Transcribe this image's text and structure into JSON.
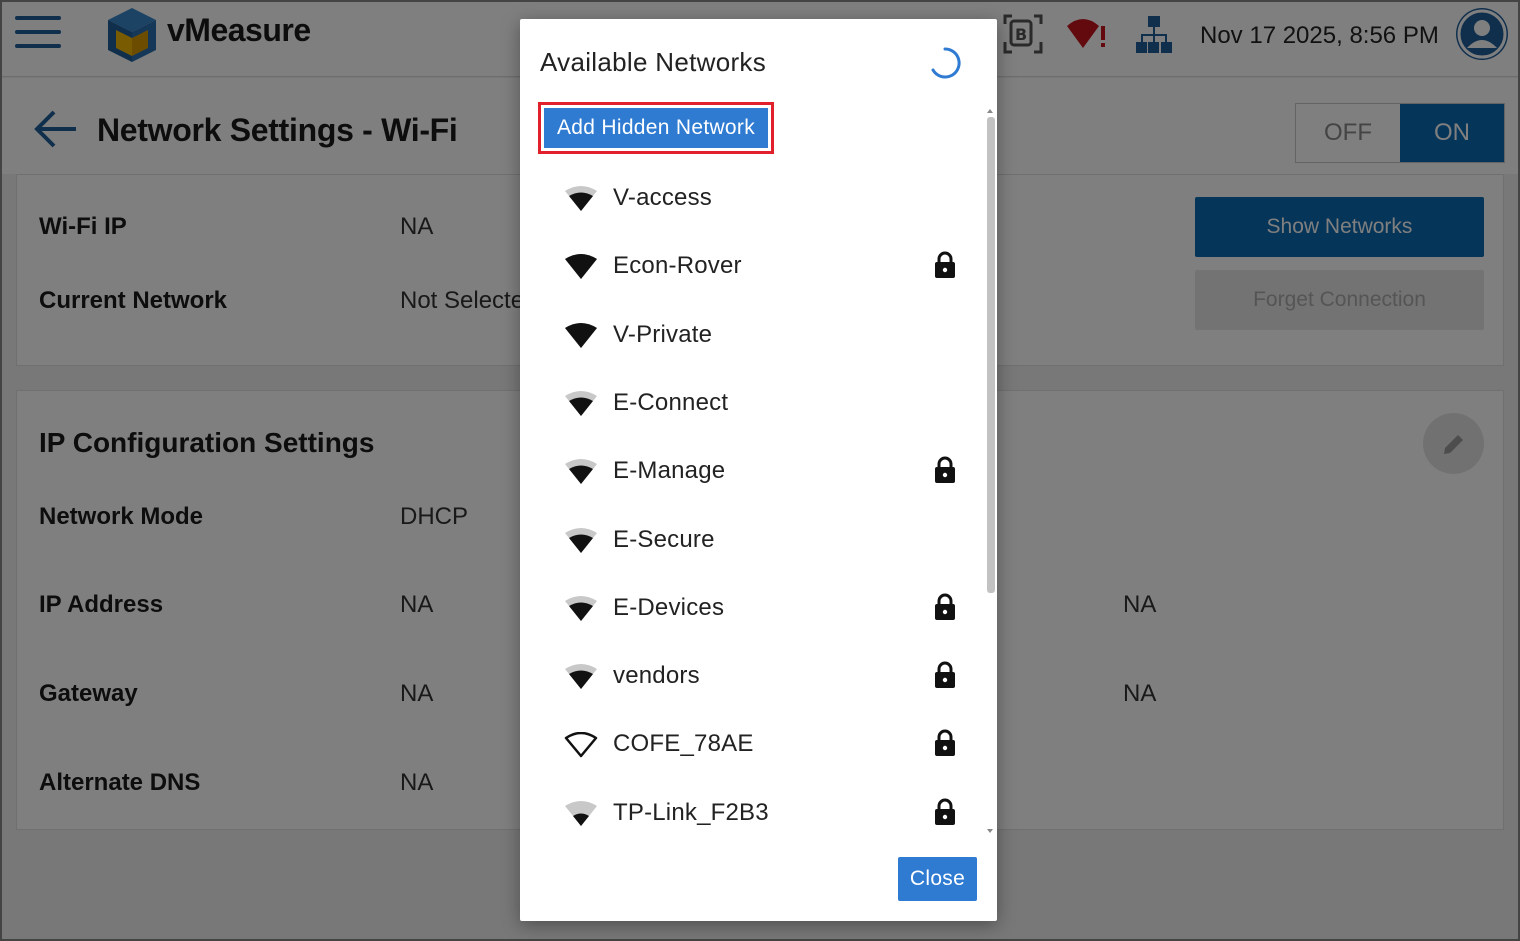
{
  "app": {
    "title": "vMeasure",
    "datetime": "Nov 17 2025, 8:56 PM",
    "colors": {
      "primary": "#0a6bb3",
      "dialog_button": "#2f7bd2",
      "highlight": "#e2202c",
      "alert": "#c4151c"
    }
  },
  "page": {
    "title": "Network Settings - Wi-Fi",
    "toggle": {
      "off_label": "OFF",
      "on_label": "ON",
      "selected": "ON"
    },
    "wifi_info": {
      "wifi_ip_label": "Wi-Fi IP",
      "wifi_ip_value": "NA",
      "current_network_label": "Current Network",
      "current_network_value": "Not Selected"
    },
    "buttons": {
      "show_networks": "Show Networks",
      "forget_connection": "Forget Connection"
    },
    "ip_config": {
      "title": "IP Configuration Settings",
      "network_mode_label": "Network Mode",
      "network_mode_value": "DHCP",
      "ip_address_label": "IP Address",
      "ip_address_value": "NA",
      "gateway_label": "Gateway",
      "gateway_value": "NA",
      "alternate_dns_label": "Alternate DNS",
      "alternate_dns_value": "NA",
      "right_value_1": "NA",
      "right_value_2": "NA"
    }
  },
  "dialog": {
    "title": "Available Networks",
    "add_hidden_label": "Add Hidden Network",
    "close_label": "Close",
    "networks": [
      {
        "name": "V-access",
        "strength": 3,
        "locked": false
      },
      {
        "name": "Econ-Rover",
        "strength": 4,
        "locked": true
      },
      {
        "name": "V-Private",
        "strength": 4,
        "locked": false
      },
      {
        "name": "E-Connect",
        "strength": 3,
        "locked": false
      },
      {
        "name": "E-Manage",
        "strength": 3,
        "locked": true
      },
      {
        "name": "E-Secure",
        "strength": 3,
        "locked": false
      },
      {
        "name": "E-Devices",
        "strength": 3,
        "locked": true
      },
      {
        "name": "vendors",
        "strength": 3,
        "locked": true
      },
      {
        "name": "COFE_78AE",
        "strength": 0,
        "locked": true
      },
      {
        "name": "TP-Link_F2B3",
        "strength": 2,
        "locked": true
      }
    ]
  }
}
